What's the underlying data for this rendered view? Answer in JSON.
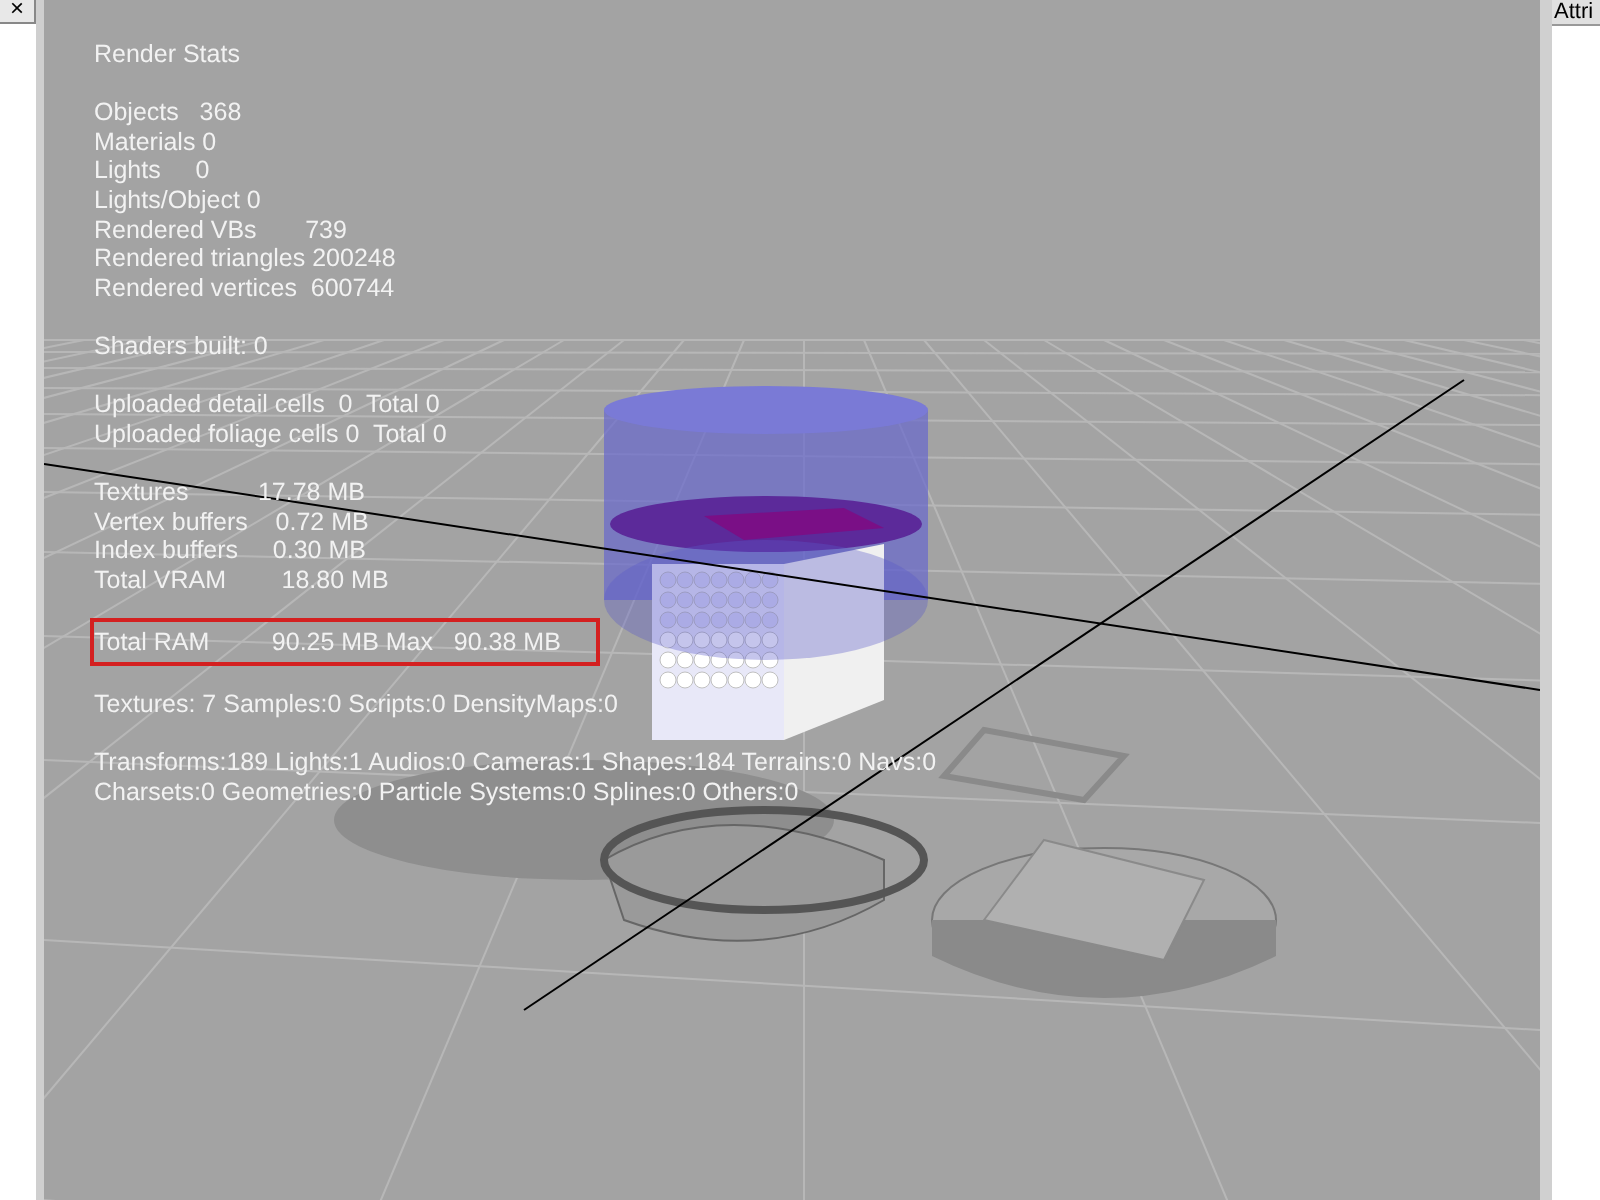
{
  "left_panel": {
    "close_label": "×"
  },
  "right_panel": {
    "header": "Attri"
  },
  "stats": {
    "title": "Render Stats",
    "groups": [
      [
        {
          "text": "Objects   368",
          "highlighted": false
        },
        {
          "text": "Materials 0",
          "highlighted": false
        },
        {
          "text": "Lights     0",
          "highlighted": false
        },
        {
          "text": "Lights/Object 0",
          "highlighted": false
        },
        {
          "text": "Rendered VBs       739",
          "highlighted": false
        },
        {
          "text": "Rendered triangles 200248",
          "highlighted": false
        },
        {
          "text": "Rendered vertices  600744",
          "highlighted": false
        }
      ],
      [
        {
          "text": "Shaders built: 0",
          "highlighted": false
        }
      ],
      [
        {
          "text": "Uploaded detail cells  0  Total 0",
          "highlighted": false
        },
        {
          "text": "Uploaded foliage cells 0  Total 0",
          "highlighted": false
        }
      ],
      [
        {
          "text": "Textures          17.78 MB",
          "highlighted": false
        },
        {
          "text": "Vertex buffers    0.72 MB",
          "highlighted": false
        },
        {
          "text": "Index buffers     0.30 MB",
          "highlighted": false
        },
        {
          "text": "Total VRAM        18.80 MB",
          "highlighted": false
        }
      ],
      [
        {
          "text": "Total RAM         90.25 MB Max   90.38 MB",
          "highlighted": true
        }
      ],
      [
        {
          "text": "Textures: 7 Samples:0 Scripts:0 DensityMaps:0",
          "highlighted": false
        }
      ],
      [
        {
          "text": "Transforms:189 Lights:1 Audios:0 Cameras:1 Shapes:184 Terrains:0 Navs:0",
          "highlighted": false
        },
        {
          "text": "Charsets:0 Geometries:0 Particle Systems:0 Splines:0 Others:0",
          "highlighted": false
        }
      ]
    ]
  }
}
